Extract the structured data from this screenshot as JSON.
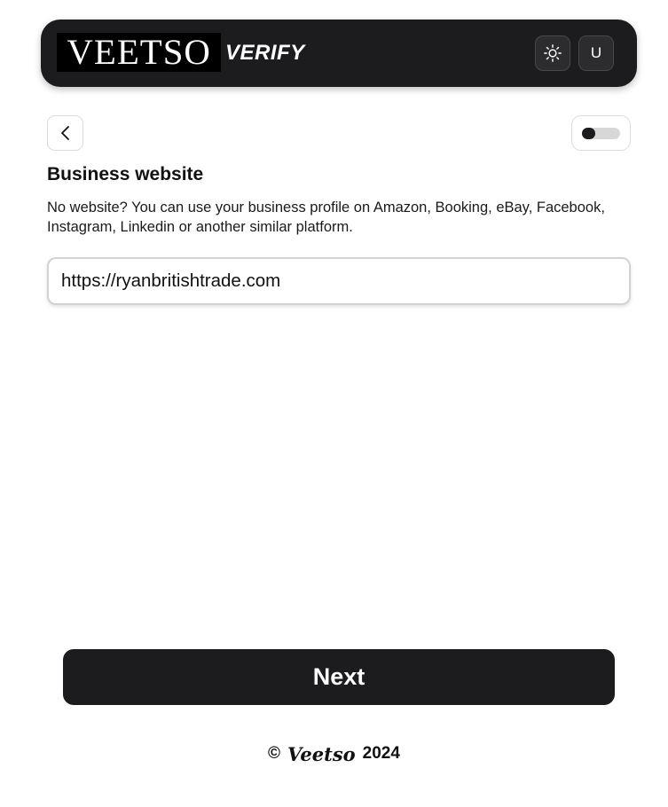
{
  "header": {
    "logo_text": "VEETSO",
    "verify_text": "VERIFY",
    "theme_icon": "sun-icon",
    "user_initial": "U"
  },
  "nav": {
    "back_icon": "chevron-left-icon",
    "toggle_state": "off"
  },
  "form": {
    "title": "Business website",
    "description": "No website? You can use your business profile on Amazon, Booking, eBay, Facebook, Instagram, Linkedin or another similar platform.",
    "website_value": "https://ryanbritishtrade.com",
    "next_label": "Next"
  },
  "footer": {
    "copyright_symbol": "©",
    "brand": "Veetso",
    "year": "2024"
  },
  "colors": {
    "primary_dark": "#1c1c1e",
    "background": "#ffffff",
    "border": "#dcdcdc"
  }
}
